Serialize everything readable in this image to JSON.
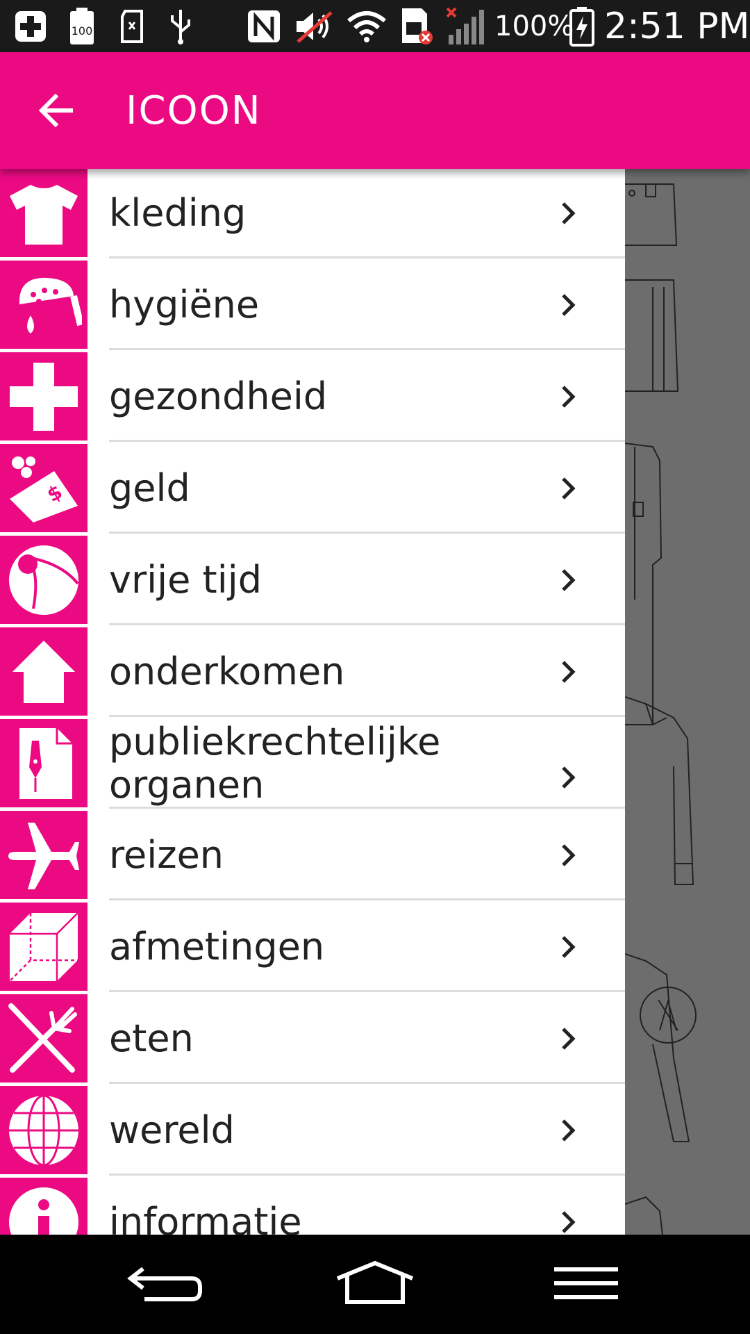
{
  "status_bar": {
    "battery_percent": "100%",
    "time": "2:51 PM",
    "icons": [
      "add-icon",
      "battery-100-icon",
      "sd-card-icon",
      "usb-icon",
      "nfc-icon",
      "mute-icon",
      "wifi-icon",
      "sim-error-icon",
      "no-signal-icon",
      "battery-charging-icon"
    ]
  },
  "app_bar": {
    "title": "ICOON",
    "back_icon": "arrow-left-icon",
    "color": "#ec0a83"
  },
  "menu": {
    "items": [
      {
        "label": "kleding",
        "icon": "t-shirt-icon"
      },
      {
        "label": "hygiëne",
        "icon": "shower-icon"
      },
      {
        "label": "gezondheid",
        "icon": "medical-cross-icon"
      },
      {
        "label": "geld",
        "icon": "money-icon"
      },
      {
        "label": "vrije tijd",
        "icon": "beach-ball-icon"
      },
      {
        "label": "onderkomen",
        "icon": "house-icon"
      },
      {
        "label": "publiekrechtelijke organen",
        "icon": "document-pen-icon"
      },
      {
        "label": "reizen",
        "icon": "airplane-icon"
      },
      {
        "label": "afmetingen",
        "icon": "cube-icon"
      },
      {
        "label": "eten",
        "icon": "fork-knife-icon"
      },
      {
        "label": "wereld",
        "icon": "globe-icon"
      },
      {
        "label": "informatie",
        "icon": "info-icon"
      }
    ]
  },
  "nav_bar": {
    "buttons": [
      "back-icon",
      "home-icon",
      "menu-icon"
    ]
  }
}
